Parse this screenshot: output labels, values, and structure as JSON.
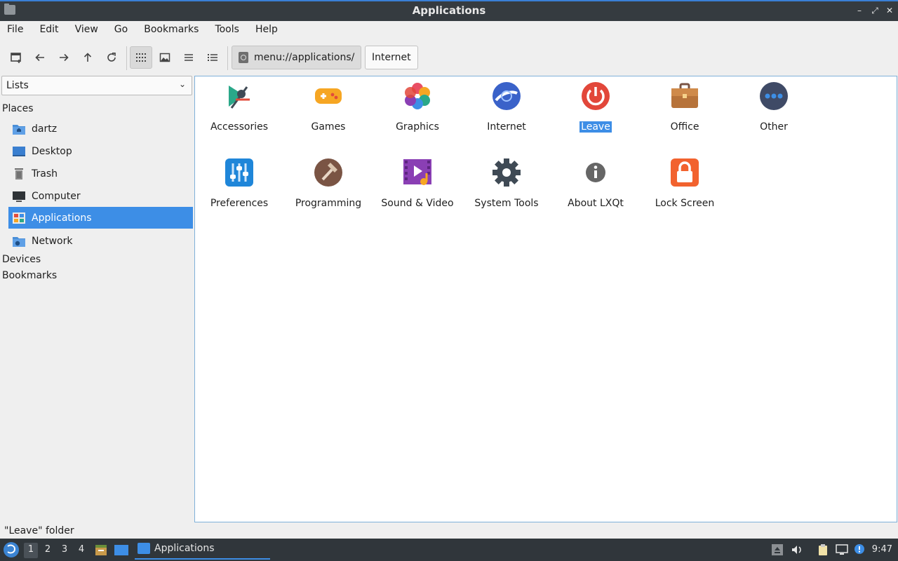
{
  "window": {
    "title": "Applications"
  },
  "menubar": [
    "File",
    "Edit",
    "View",
    "Go",
    "Bookmarks",
    "Tools",
    "Help"
  ],
  "toolbar": {
    "path_current": "menu://applications/",
    "path_next": "Internet"
  },
  "sidebar": {
    "dropdown_value": "Lists",
    "places_label": "Places",
    "places": [
      {
        "label": "dartz",
        "icon": "home-folder-icon"
      },
      {
        "label": "Desktop",
        "icon": "desktop-icon"
      },
      {
        "label": "Trash",
        "icon": "trash-icon"
      },
      {
        "label": "Computer",
        "icon": "computer-icon"
      },
      {
        "label": "Applications",
        "icon": "applications-icon",
        "selected": true
      },
      {
        "label": "Network",
        "icon": "network-icon"
      }
    ],
    "devices_label": "Devices",
    "bookmarks_label": "Bookmarks"
  },
  "items": [
    {
      "label": "Accessories",
      "icon": "accessories-icon",
      "color": "#2aa889"
    },
    {
      "label": "Games",
      "icon": "games-icon",
      "color": "#f6a623"
    },
    {
      "label": "Graphics",
      "icon": "graphics-icon",
      "color": "#e94f64"
    },
    {
      "label": "Internet",
      "icon": "internet-icon",
      "color": "#3a62c9"
    },
    {
      "label": "Leave",
      "icon": "power-icon",
      "color": "#e2473a",
      "selected": true
    },
    {
      "label": "Office",
      "icon": "office-briefcase-icon",
      "color": "#b7733a"
    },
    {
      "label": "Other",
      "icon": "other-icon",
      "color": "#3f4a66"
    },
    {
      "label": "Preferences",
      "icon": "preferences-icon",
      "color": "#1f86d9"
    },
    {
      "label": "Programming",
      "icon": "programming-hammer-icon",
      "color": "#7a5444"
    },
    {
      "label": "Sound & Video",
      "icon": "sound-video-icon",
      "color": "#8a3fb4"
    },
    {
      "label": "System Tools",
      "icon": "system-tools-gear-icon",
      "color": "#3f4a55"
    },
    {
      "label": "About LXQt",
      "icon": "info-icon",
      "color": "#666666"
    },
    {
      "label": "Lock Screen",
      "icon": "lock-icon",
      "color": "#f2622e"
    }
  ],
  "status": {
    "text": "\"Leave\" folder"
  },
  "taskbar": {
    "desktops": [
      "1",
      "2",
      "3",
      "4"
    ],
    "active_app": "Applications",
    "clock": "9:47"
  },
  "colors": {
    "accent": "#3d8ee6",
    "titlebar": "#353b40",
    "taskbar": "#30363b"
  }
}
